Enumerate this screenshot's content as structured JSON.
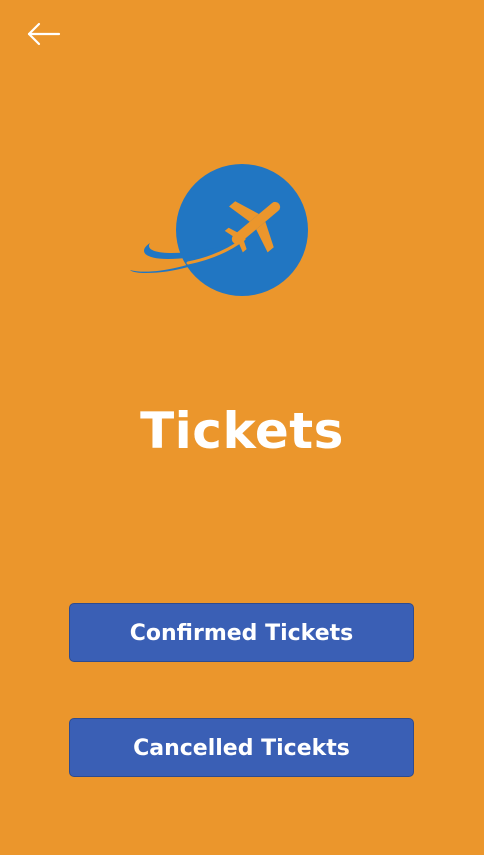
{
  "header": {
    "back_icon": "arrow-left-icon"
  },
  "logo": {
    "icon": "airplane-globe-icon",
    "circle_color": "#2176C2",
    "plane_color": "#EB962C"
  },
  "main": {
    "title": "Tickets"
  },
  "actions": {
    "confirmed_label": "Confirmed Tickets",
    "cancelled_label": "Cancelled Ticekts"
  },
  "colors": {
    "background": "#EB962C",
    "button": "#3A5FB5",
    "text": "#FFFFFF"
  }
}
